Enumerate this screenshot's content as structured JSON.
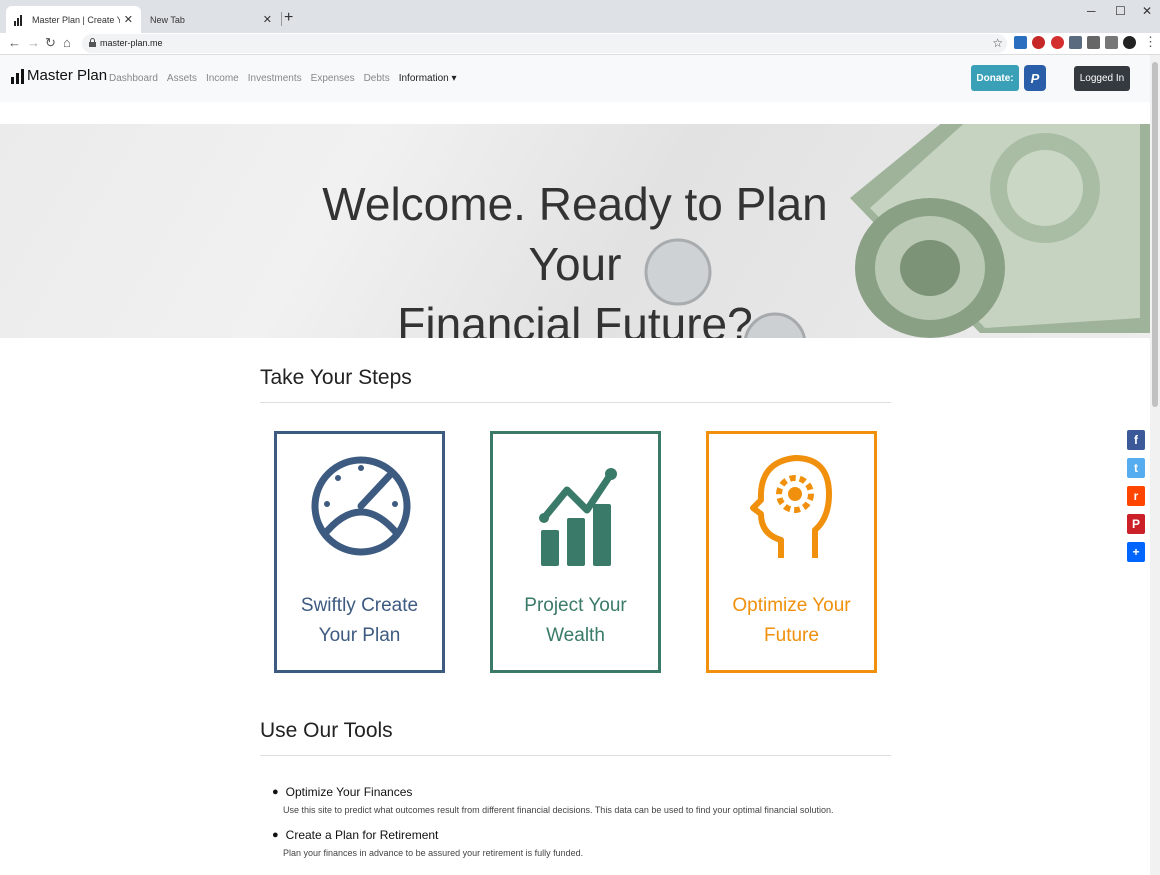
{
  "browser": {
    "tabs": [
      {
        "label": "Master Plan | Create Your Financ",
        "close": "✕"
      },
      {
        "label": "New Tab",
        "close": "✕"
      }
    ],
    "new_tab": "+",
    "window_controls": {
      "minimize": "─",
      "maximize": "☐",
      "close": "✕"
    },
    "nav": {
      "back": "←",
      "forward": "→",
      "reload": "↻",
      "home": "⌂"
    },
    "url": "master-plan.me",
    "bookmark_star": "☆",
    "menu": "⋮"
  },
  "site": {
    "brand": "Master Plan",
    "nav_links": [
      "Dashboard",
      "Assets",
      "Income",
      "Investments",
      "Expenses",
      "Debts"
    ],
    "info_menu": "Information ▾",
    "donate": "Donate:",
    "paypal": "P",
    "logged_in": "Logged In"
  },
  "hero": {
    "title_line1": "Welcome. Ready to Plan Your",
    "title_line2": "Financial Future?"
  },
  "steps": {
    "heading": "Take Your Steps",
    "cards": [
      {
        "line1": "Swiftly Create",
        "line2": "Your Plan",
        "color": "#3d5a80",
        "icon": "speedometer-icon"
      },
      {
        "line1": "Project Your",
        "line2": "Wealth",
        "color": "#3a7a68",
        "icon": "growth-chart-icon"
      },
      {
        "line1": "Optimize Your",
        "line2": "Future",
        "color": "#f0900c",
        "icon": "head-gear-icon"
      }
    ]
  },
  "tools": {
    "heading": "Use Our Tools",
    "items": [
      {
        "title": "Optimize Your Finances",
        "desc": "Use this site to predict what outcomes result from different financial decisions. This data can be used to find your optimal financial solution."
      },
      {
        "title": "Create a Plan for Retirement",
        "desc": "Plan your finances in advance to be assured your retirement is fully funded."
      }
    ]
  },
  "share": {
    "facebook": "f",
    "twitter": "t",
    "reddit": "r",
    "pinterest": "P",
    "more": "+",
    "colors": {
      "facebook": "#3b5998",
      "twitter": "#55acee",
      "reddit": "#ff4500",
      "pinterest": "#cb2027",
      "more": "#0166ff"
    }
  }
}
